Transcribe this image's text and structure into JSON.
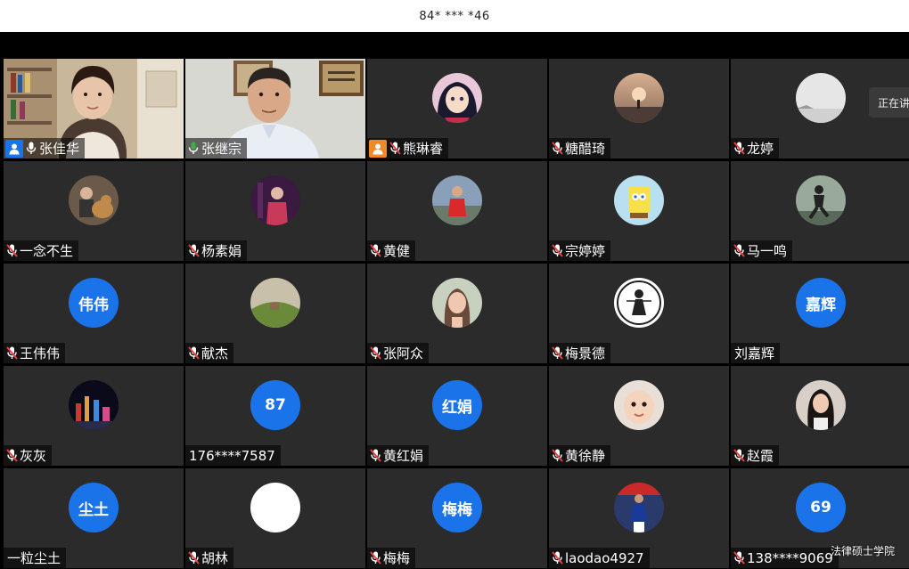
{
  "window": {
    "title": "84* *** *46"
  },
  "popup": {
    "text": "正在讲话"
  },
  "watermark": {
    "text": "法律硕士学院"
  },
  "colors": {
    "accent": "#1a73e8",
    "speaking": "#3cb043",
    "mutedMic": "#e04444"
  },
  "participants": [
    {
      "name": "张佳华",
      "kind": "video",
      "mic": "on",
      "badge": "host",
      "scene": "woman-bookshelf"
    },
    {
      "name": "张继宗",
      "kind": "video",
      "mic": "on-green",
      "speaking": true,
      "scene": "man-plaque"
    },
    {
      "name": "熊琳睿",
      "kind": "photo",
      "mic": "muted",
      "badge": "cohost",
      "photo": "anime-girl"
    },
    {
      "name": "糖醋琦",
      "kind": "photo",
      "mic": "muted",
      "photo": "sunset-sea"
    },
    {
      "name": "龙婷",
      "kind": "photo",
      "mic": "muted",
      "photo": "foggy-landscape"
    },
    {
      "name": "一念不生",
      "kind": "photo",
      "mic": "muted",
      "photo": "person-dog"
    },
    {
      "name": "杨素娟",
      "kind": "photo",
      "mic": "muted",
      "photo": "woman-red"
    },
    {
      "name": "黄健",
      "kind": "photo",
      "mic": "muted",
      "photo": "man-red-shirt"
    },
    {
      "name": "宗婷婷",
      "kind": "photo",
      "mic": "muted",
      "photo": "cartoon-sponge"
    },
    {
      "name": "马一鸣",
      "kind": "photo",
      "mic": "muted",
      "photo": "runner"
    },
    {
      "name": "王伟伟",
      "kind": "initials",
      "initials": "伟伟",
      "mic": "muted"
    },
    {
      "name": "献杰",
      "kind": "photo",
      "mic": "muted",
      "photo": "village-hill"
    },
    {
      "name": "张阿众",
      "kind": "photo",
      "mic": "muted",
      "photo": "woman-portrait"
    },
    {
      "name": "梅景德",
      "kind": "photo",
      "mic": "muted",
      "photo": "justice-logo"
    },
    {
      "name": "刘嘉辉",
      "kind": "initials",
      "initials": "嘉辉",
      "mic": "none"
    },
    {
      "name": "灰灰",
      "kind": "photo",
      "mic": "muted",
      "photo": "night-city"
    },
    {
      "name": "176****7587",
      "kind": "initials",
      "initials": "87",
      "mic": "none"
    },
    {
      "name": "黄红娟",
      "kind": "initials",
      "initials": "红娟",
      "mic": "muted"
    },
    {
      "name": "黄徐静",
      "kind": "photo",
      "mic": "muted",
      "photo": "baby"
    },
    {
      "name": "赵霞",
      "kind": "photo",
      "mic": "muted",
      "photo": "woman-dark-hair"
    },
    {
      "name": "一粒尘土",
      "kind": "initials",
      "initials": "尘土",
      "mic": "none"
    },
    {
      "name": "胡林",
      "kind": "white",
      "mic": "muted"
    },
    {
      "name": "梅梅",
      "kind": "initials",
      "initials": "梅梅",
      "mic": "muted"
    },
    {
      "name": "laodao4927",
      "kind": "photo",
      "mic": "muted",
      "photo": "soccer-player"
    },
    {
      "name": "138****9069",
      "kind": "initials",
      "initials": "69",
      "mic": "muted"
    }
  ]
}
